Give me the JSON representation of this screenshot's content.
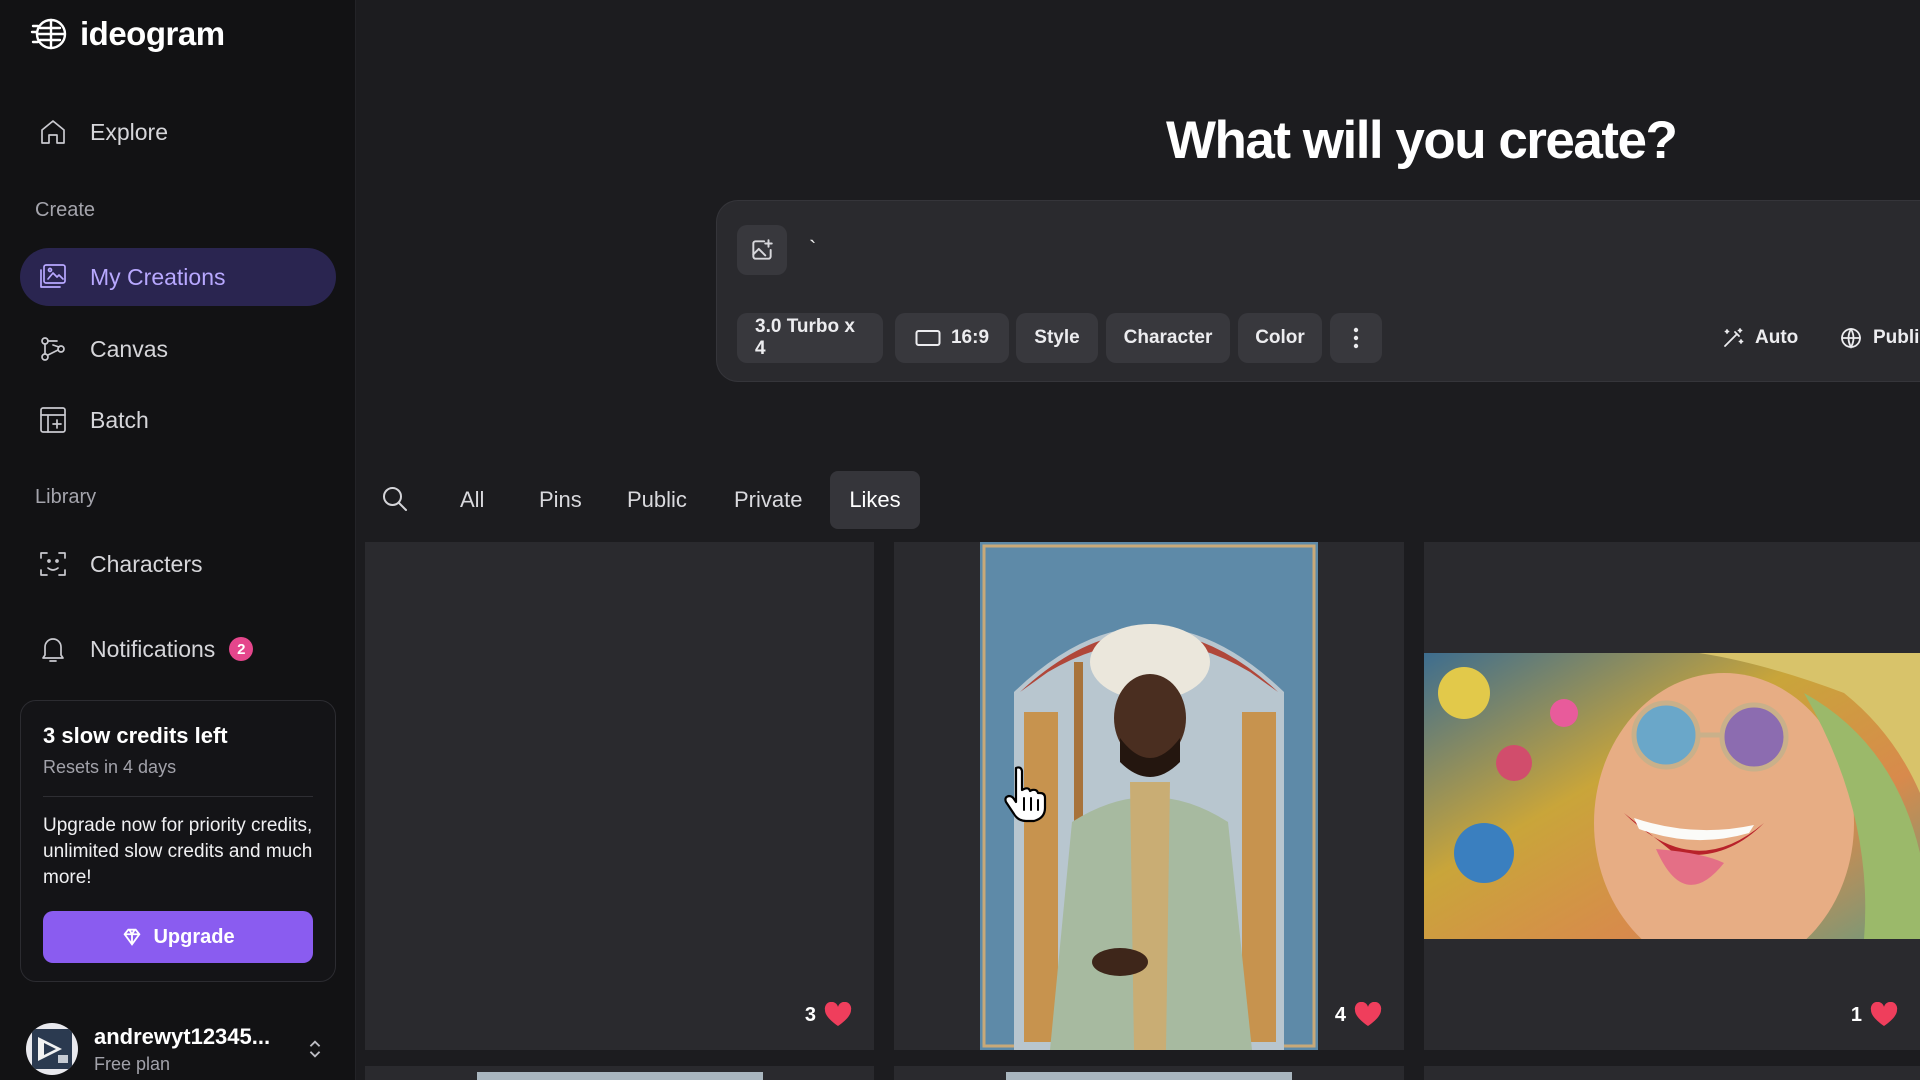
{
  "brand": {
    "name": "ideogram"
  },
  "nav": {
    "explore": "Explore",
    "create_section": "Create",
    "my_creations": "My Creations",
    "canvas": "Canvas",
    "batch": "Batch",
    "library_section": "Library",
    "characters": "Characters",
    "notifications": "Notifications",
    "notifications_count": "2"
  },
  "credits": {
    "title": "3 slow credits left",
    "resets": "Resets in 4 days",
    "message": "Upgrade now for priority credits, unlimited slow credits and much more!",
    "upgrade_label": "Upgrade"
  },
  "user": {
    "name": "andrewyt12345...",
    "plan": "Free plan"
  },
  "main": {
    "headline": "What will you create?",
    "prompt": {
      "value": "`",
      "placeholder": ""
    },
    "chips": {
      "model": "3.0 Turbo x 4",
      "aspect": "16:9",
      "style": "Style",
      "character": "Character",
      "color": "Color",
      "magic": "Auto",
      "visibility": "Public"
    },
    "filters": [
      "All",
      "Pins",
      "Public",
      "Private",
      "Likes"
    ],
    "active_filter": "Likes",
    "gallery": [
      {
        "likes": "3"
      },
      {
        "likes": "4"
      },
      {
        "likes": "1"
      }
    ]
  },
  "colors": {
    "accent": "#8a5cf0",
    "active_nav_bg": "#2a2550",
    "active_nav_text": "#b8a8ff",
    "badge": "#e5468c",
    "heart": "#ef3e5c"
  }
}
